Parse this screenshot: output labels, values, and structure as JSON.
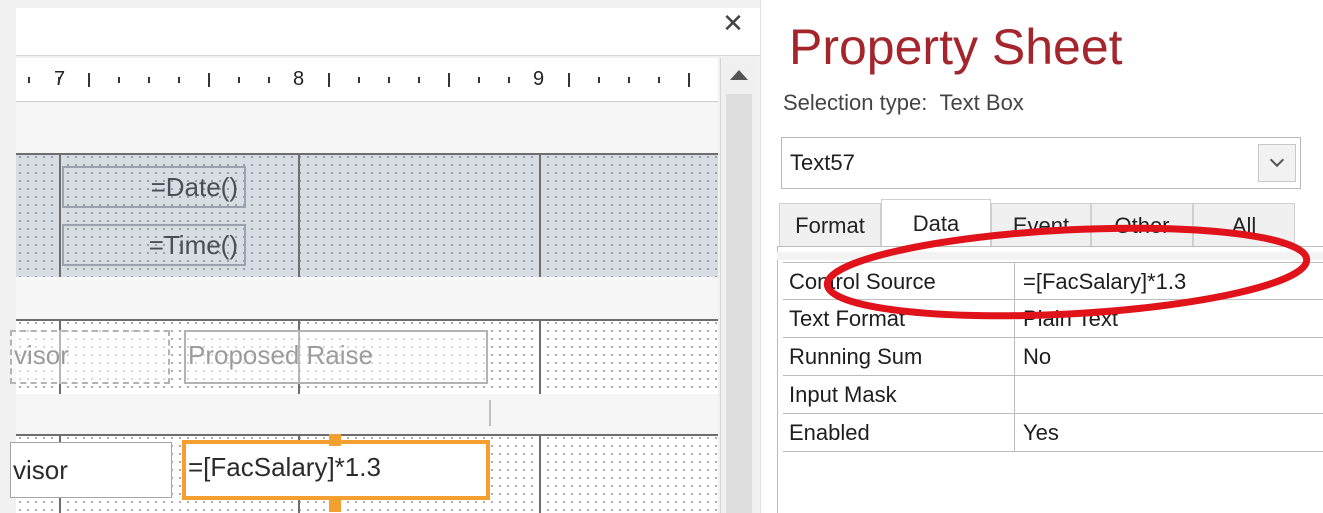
{
  "design": {
    "close_glyph": "✕",
    "ruler": {
      "labels": [
        "7",
        "8",
        "9"
      ]
    },
    "header_controls": [
      "=Date()",
      "=Time()"
    ],
    "labels": {
      "advisor_partial": "visor",
      "proposed_raise": "Proposed Raise"
    },
    "detail": {
      "advisor_partial": "visor",
      "selected_textbox": "=[FacSalary]*1.3"
    }
  },
  "property_sheet": {
    "title": "Property Sheet",
    "selection_type_label": "Selection type:",
    "selection_type_value": "Text Box",
    "object_selector": {
      "value": "Text57"
    },
    "tabs": [
      "Format",
      "Data",
      "Event",
      "Other",
      "All"
    ],
    "active_tab": "Data",
    "rows": [
      {
        "name": "Control Source",
        "value": "=[FacSalary]*1.3"
      },
      {
        "name": "Text Format",
        "value": "Plain Text"
      },
      {
        "name": "Running Sum",
        "value": "No"
      },
      {
        "name": "Input Mask",
        "value": ""
      },
      {
        "name": "Enabled",
        "value": "Yes"
      }
    ],
    "annotation_color": "#e0121a"
  },
  "colors": {
    "title": "#a4262c",
    "selection": "#f4a030"
  }
}
